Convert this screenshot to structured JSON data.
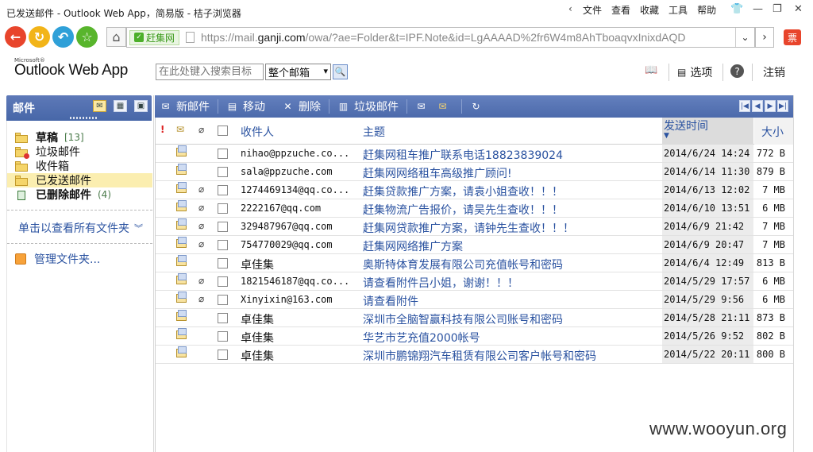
{
  "browser": {
    "window_title": "已发送邮件 - Outlook Web App，简易版 - 桔子浏览器",
    "menus": [
      "文件",
      "查看",
      "收藏",
      "工具",
      "帮助"
    ],
    "url_badge": "赶集网",
    "url_prefix": "https://mail.",
    "url_domain": "ganji.com",
    "url_rest": "/owa/?ae=Folder&t=IPF.Note&id=LgAAAAD%2fr6W4m8AhTboaqvxInixdAQD",
    "ticket_label": "票"
  },
  "header": {
    "brand_small": "Microsoft®",
    "brand": "Outlook Web App",
    "search_placeholder": "在此处键入搜索目标",
    "search_scope": "整个邮箱",
    "options_label": "选项",
    "signout_label": "注销"
  },
  "left_pane": {
    "title": "邮件",
    "folders": [
      {
        "label": "草稿",
        "count": "[13]",
        "bold": true
      },
      {
        "label": "垃圾邮件",
        "count": "",
        "bold": false
      },
      {
        "label": "收件箱",
        "count": "",
        "bold": false
      },
      {
        "label": "已发送邮件",
        "count": "",
        "bold": false,
        "selected": true
      },
      {
        "label": "已删除邮件",
        "count": "(4)",
        "bold": true
      }
    ],
    "show_all_label": "单击以查看所有文件夹",
    "manage_label": "管理文件夹..."
  },
  "toolbar": {
    "new_label": "新邮件",
    "move_label": "移动",
    "delete_label": "删除",
    "junk_label": "垃圾邮件"
  },
  "list": {
    "headers": {
      "to": "收件人",
      "subject": "主题",
      "sent": "发送时间",
      "size": "大小"
    },
    "rows": [
      {
        "to": "nihao@ppzuche.co...",
        "to_cn": false,
        "subject": "赶集网租车推广联系电话18823839024",
        "date": "2014/6/24 14:24",
        "size": "772 B",
        "attach": false
      },
      {
        "to": "sala@ppzuche.com",
        "to_cn": false,
        "subject": "赶集网网络租车高级推广顾问!",
        "date": "2014/6/14 11:30",
        "size": "879 B",
        "attach": false
      },
      {
        "to": "1274469134@qq.co...",
        "to_cn": false,
        "subject": "赶集贷款推广方案，请袁小姐查收！！！",
        "date": "2014/6/13 12:02",
        "size": "7 MB",
        "attach": true
      },
      {
        "to": "2222167@qq.com",
        "to_cn": false,
        "subject": "赶集物流广告报价，请吴先生查收！！！",
        "date": "2014/6/10 13:51",
        "size": "6 MB",
        "attach": true
      },
      {
        "to": "329487967@qq.com",
        "to_cn": false,
        "subject": "赶集网贷款推广方案，请钟先生查收！！！",
        "date": "2014/6/9 21:42",
        "size": "7 MB",
        "attach": true
      },
      {
        "to": "754770029@qq.com",
        "to_cn": false,
        "subject": "赶集网网络推广方案",
        "date": "2014/6/9 20:47",
        "size": "7 MB",
        "attach": true
      },
      {
        "to": "卓佳集",
        "to_cn": true,
        "subject": "奥斯特体育发展有限公司充值帐号和密码",
        "date": "2014/6/4 12:49",
        "size": "813 B",
        "attach": false
      },
      {
        "to": "1821546187@qq.co...",
        "to_cn": false,
        "subject": "请查看附件吕小姐，谢谢！！！",
        "date": "2014/5/29 17:57",
        "size": "6 MB",
        "attach": true
      },
      {
        "to": "Xinyixin@163.com",
        "to_cn": false,
        "subject": "请查看附件",
        "date": "2014/5/29 9:56",
        "size": "6 MB",
        "attach": true
      },
      {
        "to": "卓佳集",
        "to_cn": true,
        "subject": "深圳市全脑智赢科技有限公司账号和密码",
        "date": "2014/5/28 21:11",
        "size": "873 B",
        "attach": false
      },
      {
        "to": "卓佳集",
        "to_cn": true,
        "subject": "华艺市艺充值2000帐号",
        "date": "2014/5/26 9:52",
        "size": "802 B",
        "attach": false
      },
      {
        "to": "卓佳集",
        "to_cn": true,
        "subject": "深圳市鹏锦翔汽车租赁有限公司客户帐号和密码",
        "date": "2014/5/22 20:11",
        "size": "800 B",
        "attach": false
      }
    ]
  },
  "watermark": "www.wooyun.org"
}
